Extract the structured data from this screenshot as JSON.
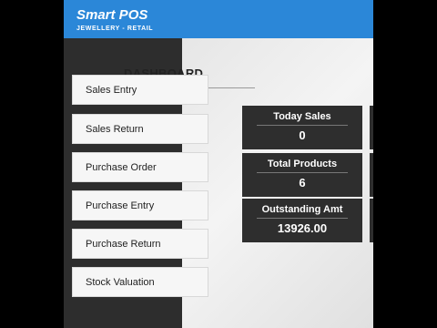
{
  "header": {
    "brand": "Smart POS",
    "tagline": "JEWELLERY - RETAIL"
  },
  "sidebar": {
    "items": [
      {
        "label": "Sales Entry"
      },
      {
        "label": "Sales Return"
      },
      {
        "label": "Purchase Order"
      },
      {
        "label": "Purchase Entry"
      },
      {
        "label": "Purchase Return"
      },
      {
        "label": "Stock Valuation"
      }
    ]
  },
  "dashboard": {
    "title": "DASHBOARD",
    "cards": [
      {
        "label": "Today Sales",
        "value": "0"
      },
      {
        "label": "Total Products",
        "value": "6"
      },
      {
        "label": "Outstanding Amt",
        "value": "13926.00"
      }
    ]
  },
  "colors": {
    "header": "#2b87d8",
    "sidebar": "#2d2d2d",
    "card": "#2e2e2e"
  }
}
